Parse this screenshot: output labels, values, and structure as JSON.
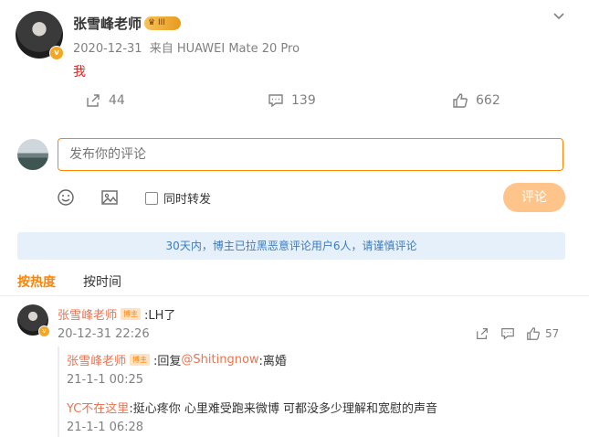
{
  "post": {
    "author": "张雪峰老师",
    "badge_level": "III",
    "date": "2020-12-31",
    "source": "来自 HUAWEI Mate 20 Pro",
    "text": "我",
    "verified_mark": "v",
    "stats": {
      "reposts": "44",
      "comments": "139",
      "likes": "662"
    }
  },
  "composer": {
    "placeholder": "发布你的评论",
    "repost_label": "同时转发",
    "submit_label": "评论"
  },
  "notice": "30天内，博主已拉黑恶意评论用户6人，请谨慎评论",
  "sort": {
    "hot": "按热度",
    "time": "按时间"
  },
  "comment": {
    "user": "张雪峰老师",
    "tag": "博主",
    "text": ":LH了",
    "time": "20-12-31 22:26",
    "likes": "57",
    "verified_mark": "v",
    "replies": [
      {
        "user": "张雪峰老师",
        "tag": "博主",
        "prefix": ":回复",
        "mention": "@Shitingnow",
        "text": ":离婚",
        "time": "21-1-1 00:25"
      },
      {
        "user": "YC不在这里",
        "tag": "",
        "prefix": "",
        "mention": "",
        "text": ":挺心疼你 心里难受跑来微博 可都没多少理解和宽慰的声音",
        "time": "21-1-1 06:28"
      }
    ]
  },
  "colors": {
    "accent": "#ff8200",
    "username": "#eb7350",
    "notice_bg": "#e5f0fa",
    "notice_text": "#3d7bbf",
    "post_text": "#eb1f1f"
  }
}
